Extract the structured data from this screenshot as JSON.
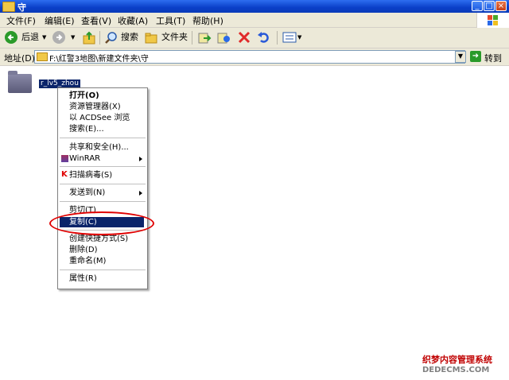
{
  "window": {
    "title": "守"
  },
  "menubar": [
    "文件(F)",
    "编辑(E)",
    "查看(V)",
    "收藏(A)",
    "工具(T)",
    "帮助(H)"
  ],
  "toolbar": {
    "back": "后退",
    "search": "搜索",
    "folders": "文件夹"
  },
  "address": {
    "label": "地址(D)",
    "value": "F:\\红警3地图\\新建文件夹\\守",
    "go": "转到"
  },
  "file": {
    "name": "r_lv5_zhou"
  },
  "context_menu": {
    "open": "打开(O)",
    "explorer": "资源管理器(X)",
    "acdsee": "以 ACDSee 浏览",
    "search": "搜索(E)...",
    "sharing": "共享和安全(H)...",
    "winrar": "WinRAR",
    "scan": "扫描病毒(S)",
    "sendto": "发送到(N)",
    "cut": "剪切(T)",
    "copy": "复制(C)",
    "shortcut": "创建快捷方式(S)",
    "delete": "删除(D)",
    "rename": "重命名(M)",
    "properties": "属性(R)"
  },
  "watermark": {
    "line1": "织梦内容管理系统",
    "line2": "DEDECMS.COM"
  }
}
